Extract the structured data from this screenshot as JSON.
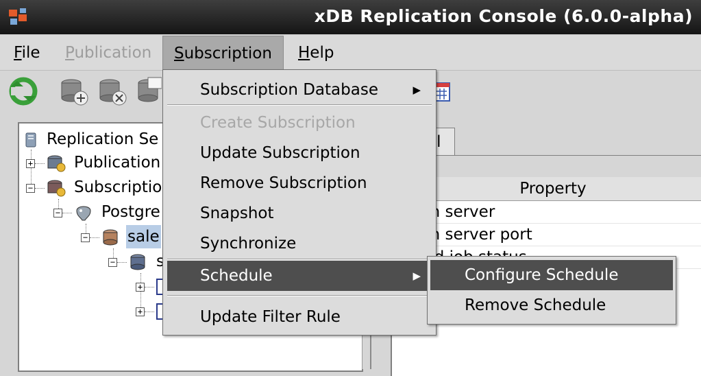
{
  "window": {
    "title": "xDB Replication Console (6.0.0-alpha)"
  },
  "menubar": {
    "file": {
      "mnemonic": "F",
      "rest": "ile"
    },
    "publication": {
      "mnemonic": "P",
      "rest": "ublication"
    },
    "subscription": {
      "mnemonic": "S",
      "rest": "ubscription"
    },
    "help": {
      "mnemonic": "H",
      "rest": "elp"
    }
  },
  "toolbar": [
    "refresh-icon",
    "add-database-icon",
    "remove-database-icon",
    "database-properties-icon",
    "calendar-icon"
  ],
  "tree": {
    "root": "Replication Se",
    "publication": "Publication",
    "subscription": "Subscriptio",
    "postgres": "Postgre",
    "sales": "sale",
    "schema": "s"
  },
  "right_panel": {
    "tab_label": "al",
    "table_header": "Property",
    "rows": [
      "ation server",
      "ation server port",
      "duled job status"
    ]
  },
  "subscription_menu": {
    "items": [
      {
        "label": "Subscription Database",
        "has_submenu": true
      },
      {
        "label": "Create Subscription",
        "disabled": true
      },
      {
        "label": "Update Subscription"
      },
      {
        "label": "Remove Subscription"
      },
      {
        "label": "Snapshot"
      },
      {
        "label": "Synchronize"
      },
      {
        "label": "Schedule",
        "has_submenu": true,
        "highlighted": true
      },
      {
        "label": "Update Filter Rule"
      }
    ]
  },
  "schedule_submenu": {
    "items": [
      {
        "label": "Configure Schedule",
        "highlighted": true
      },
      {
        "label": "Remove Schedule"
      }
    ]
  },
  "colors": {
    "title_bg": "#222222",
    "menu_highlight": "#4e4e4e",
    "selection": "#b8cde6"
  }
}
